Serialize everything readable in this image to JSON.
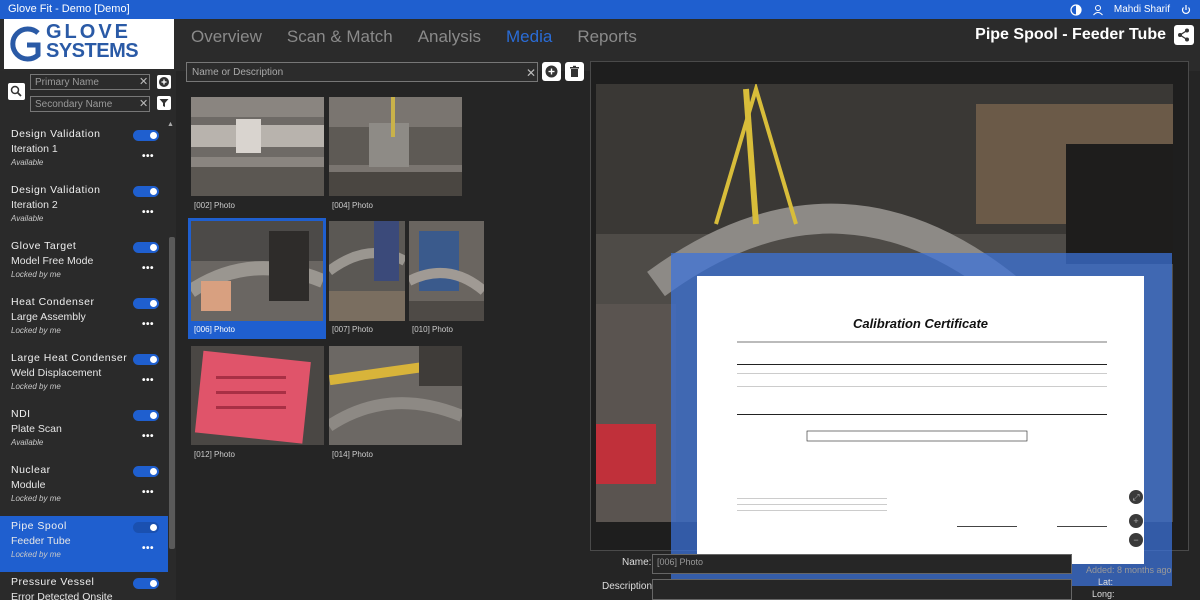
{
  "window": {
    "title": "Glove Fit - Demo [Demo]",
    "user": "Mahdi Sharif"
  },
  "logo": {
    "text_line1": "GLOVE",
    "text_line2": "SYSTEMS"
  },
  "nav": {
    "tabs": [
      "Overview",
      "Scan & Match",
      "Analysis",
      "Media",
      "Reports"
    ],
    "active": "Media"
  },
  "page_title": "Pipe Spool - Feeder Tube",
  "filters": {
    "primary_placeholder": "Primary Name",
    "secondary_placeholder": "Secondary Name"
  },
  "projects": [
    {
      "title": "Design Validation",
      "sub": "Iteration 1",
      "status": "Available"
    },
    {
      "title": "Design Validation",
      "sub": "Iteration 2",
      "status": "Available"
    },
    {
      "title": "Glove Target",
      "sub": "Model Free Mode",
      "status": "Locked by me"
    },
    {
      "title": "Heat Condenser",
      "sub": "Large Assembly",
      "status": "Locked by me"
    },
    {
      "title": "Large Heat Condenser",
      "sub": "Weld Displacement",
      "status": "Locked by me"
    },
    {
      "title": "NDI",
      "sub": "Plate Scan",
      "status": "Available"
    },
    {
      "title": "Nuclear",
      "sub": "Module",
      "status": "Locked by me"
    },
    {
      "title": "Pipe Spool",
      "sub": "Feeder Tube",
      "status": "Locked by me"
    },
    {
      "title": "Pressure Vessel",
      "sub": "Error Detected Onsite",
      "status": ""
    }
  ],
  "media": {
    "search_placeholder": "Name or Description",
    "thumbs": [
      "[002] Photo",
      "[004] Photo",
      "[006] Photo",
      "[007] Photo",
      "[010] Photo",
      "[012] Photo",
      "[014] Photo"
    ]
  },
  "certificate": {
    "title": "Calibration Certificate"
  },
  "details": {
    "name_label": "Name:",
    "name_value": "[006] Photo",
    "description_label": "Description:",
    "added": "Added: 8 months ago",
    "lat_label": "Lat:",
    "long_label": "Long:"
  },
  "colors": {
    "accent": "#1f5fcf",
    "background": "#252525"
  }
}
